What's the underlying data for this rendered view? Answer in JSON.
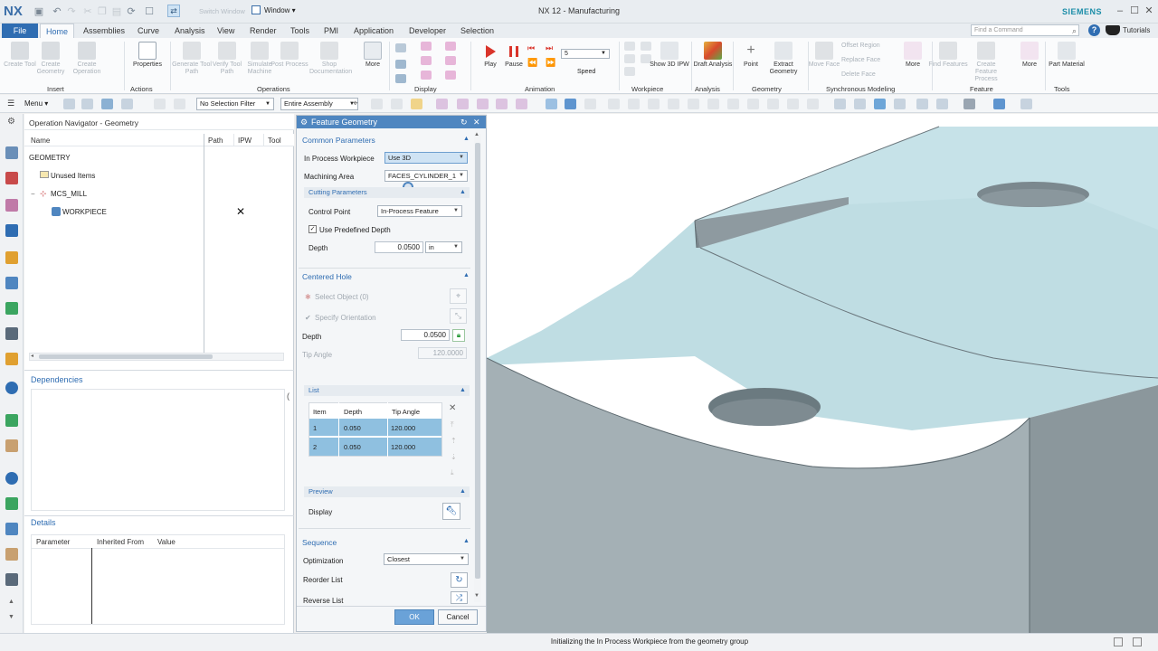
{
  "app": {
    "logo": "NX",
    "title": "NX 12 - Manufacturing",
    "brand": "SIEMENS",
    "switch_window": "Switch Window",
    "window_menu": "Window ▾"
  },
  "menu_tabs": [
    "File",
    "Home",
    "Assemblies",
    "Curve",
    "Analysis",
    "View",
    "Render",
    "Tools",
    "PMI",
    "Application",
    "Developer",
    "Selection"
  ],
  "search_placeholder": "Find a Command",
  "tutorials": "Tutorials",
  "ribbon": {
    "insert": {
      "group": "Insert",
      "buttons": [
        "Create Tool",
        "Create Geometry",
        "Create Operation"
      ]
    },
    "actions": {
      "group": "Actions",
      "buttons": [
        "Properties"
      ]
    },
    "operations": {
      "group": "Operations",
      "buttons": [
        "Generate Tool Path",
        "Verify Tool Path",
        "Simulate Machine",
        "Post Process",
        "Shop Documentation",
        "More"
      ]
    },
    "display": {
      "group": "Display"
    },
    "animation": {
      "group": "Animation",
      "buttons": [
        "Play",
        "Pause"
      ],
      "speed_label": "Speed",
      "speed_value": "5"
    },
    "workpiece": {
      "group": "Workpiece",
      "buttons": [
        "Show 3D IPW"
      ]
    },
    "analysis": {
      "group": "Analysis",
      "buttons": [
        "Draft Analysis"
      ]
    },
    "geometry": {
      "group": "Geometry",
      "buttons": [
        "Point",
        "Extract Geometry"
      ]
    },
    "sync": {
      "group": "Synchronous Modeling",
      "buttons": [
        "Move Face",
        "Offset Region",
        "Replace Face",
        "Delete Face",
        "More"
      ]
    },
    "feature": {
      "group": "Feature",
      "buttons": [
        "Find Features",
        "Create Feature Process",
        "More"
      ]
    },
    "tools": {
      "group": "Tools",
      "buttons": [
        "Part Material"
      ]
    }
  },
  "toolbar": {
    "menu": "Menu ▾",
    "selection_filter": "No Selection Filter",
    "assembly_scope": "Entire Assembly"
  },
  "navigator": {
    "title": "Operation Navigator - Geometry",
    "columns": [
      "Name",
      "Path",
      "IPW",
      "Tool"
    ],
    "rows": [
      {
        "name": "GEOMETRY",
        "ipw": ""
      },
      {
        "name": "Unused Items",
        "ipw": ""
      },
      {
        "name": "MCS_MILL",
        "ipw": ""
      },
      {
        "name": "WORKPIECE",
        "ipw": "✕"
      }
    ],
    "dependencies": "Dependencies",
    "details": "Details",
    "details_columns": [
      "Parameter",
      "Inherited From",
      "Value"
    ]
  },
  "dialog": {
    "title": "Feature Geometry",
    "common_parameters": "Common Parameters",
    "in_process_workpiece_label": "In Process Workpiece",
    "in_process_workpiece_value": "Use 3D",
    "machining_area_label": "Machining Area",
    "machining_area_value": "FACES_CYLINDER_1",
    "cutting_parameters": "Cutting Parameters",
    "control_point_label": "Control Point",
    "control_point_value": "In-Process Feature",
    "use_predefined_depth": "Use Predefined Depth",
    "depth_label": "Depth",
    "depth_value": "0.0500",
    "depth_unit": "in",
    "centered_hole": "Centered Hole",
    "select_object": "Select Object (0)",
    "specify_orientation": "Specify Orientation",
    "hole_depth_label": "Depth",
    "hole_depth_value": "0.0500",
    "tip_angle_label": "Tip Angle",
    "tip_angle_value": "120.0000",
    "list": "List",
    "list_columns": [
      "Item",
      "Depth",
      "Tip Angle"
    ],
    "list_rows": [
      {
        "item": "1",
        "depth": "0.050",
        "tip_angle": "120.000"
      },
      {
        "item": "2",
        "depth": "0.050",
        "tip_angle": "120.000"
      }
    ],
    "preview": "Preview",
    "display_label": "Display",
    "sequence": "Sequence",
    "optimization_label": "Optimization",
    "optimization_value": "Closest",
    "reorder_list": "Reorder List",
    "reverse_list": "Reverse List",
    "ok": "OK",
    "cancel": "Cancel"
  },
  "status_text": "Initializing the In Process Workpiece from the geometry group",
  "colors": {
    "accent": "#2f6db2",
    "part": "#bfdde3",
    "part_dark": "#8e9aa0",
    "hole": "#6b7a80"
  }
}
